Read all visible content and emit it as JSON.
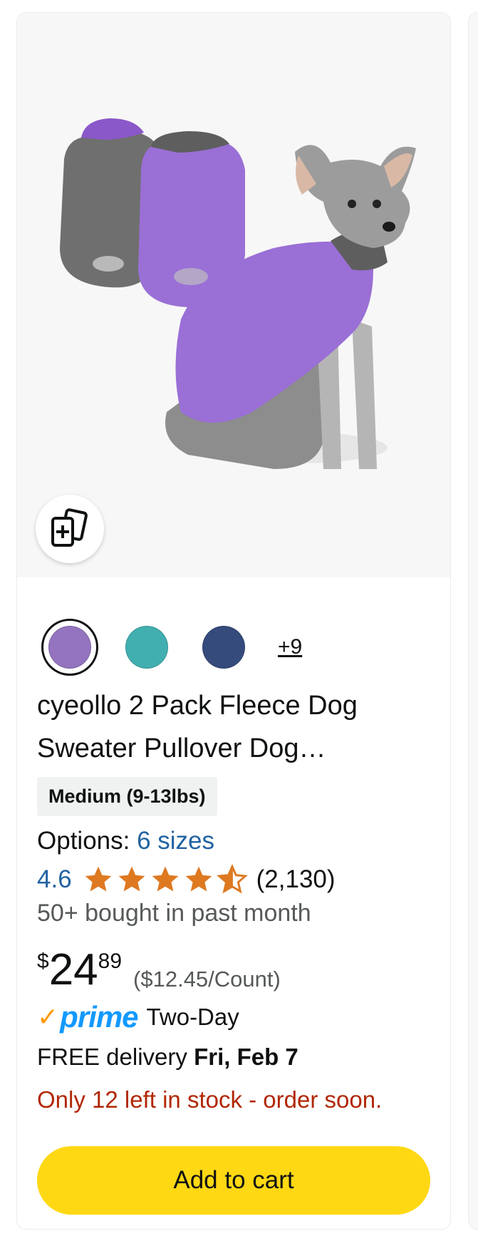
{
  "product": {
    "image_alt": "Purple and gray fleece dog sweater worn by schnauzer",
    "compare_icon": "add-to-compare-icon",
    "swatches": [
      {
        "name": "purple",
        "color": "#9474bf",
        "selected": true
      },
      {
        "name": "teal",
        "color": "#41aeb0",
        "selected": false
      },
      {
        "name": "navy",
        "color": "#354b7c",
        "selected": false
      }
    ],
    "more_swatches_label": "+9",
    "title": "cyeollo 2 Pack Fleece Dog Sweater Pullover Dog…",
    "size_label": "Medium (9-13lbs)",
    "options_label": "Options:",
    "options_link": "6 sizes",
    "rating_value": "4.6",
    "rating_stars": 4.6,
    "rating_count": "(2,130)",
    "bought_text": "50+ bought in past month",
    "price_symbol": "$",
    "price_whole": "24",
    "price_fraction": "89",
    "unit_price": "($12.45/Count)",
    "prime_label": "prime",
    "prime_delivery_type": "Two-Day",
    "delivery_prefix": "FREE delivery",
    "delivery_date": "Fri, Feb 7",
    "stock_text": "Only 12 left in stock - order soon.",
    "add_to_cart_label": "Add to cart"
  },
  "colors": {
    "link": "#2162a1",
    "star": "#de7921",
    "stock_warning": "#b12704",
    "cart_button": "#ffd814",
    "prime_blue": "#1399ff",
    "prime_check": "#ff9900"
  }
}
